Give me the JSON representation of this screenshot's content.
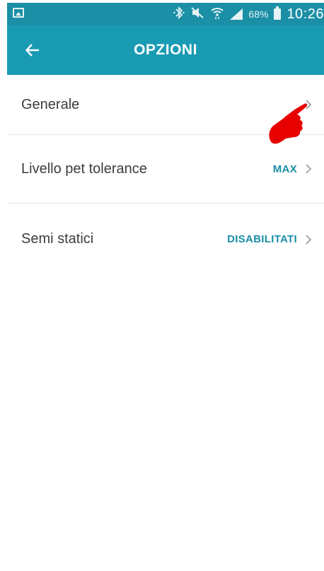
{
  "status_bar": {
    "battery_percent": "68%",
    "time": "10:26",
    "icons": [
      "image-icon",
      "bluetooth-icon",
      "mute-icon",
      "wifi-icon",
      "signal-icon",
      "battery-icon"
    ]
  },
  "app_bar": {
    "title": "OPZIONI",
    "back_icon": "arrow-left-icon",
    "color": "#1a9bb4"
  },
  "settings": {
    "items": [
      {
        "label": "Generale",
        "value": "",
        "icon": "chevron-right-icon"
      },
      {
        "label": "Livello pet tolerance",
        "value": "MAX",
        "icon": "chevron-right-icon"
      },
      {
        "label": "Semi statici",
        "value": "DISABILITATI",
        "icon": "chevron-right-icon"
      }
    ]
  },
  "annotation": {
    "icon": "pointing-hand-icon",
    "color": "#e60000"
  }
}
